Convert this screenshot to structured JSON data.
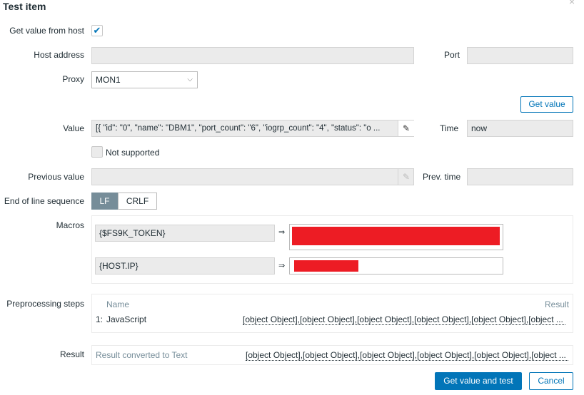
{
  "title": "Test item",
  "close_icon": "×",
  "get_value_from_host": {
    "label": "Get value from host",
    "checked": true
  },
  "host_address": {
    "label": "Host address",
    "value": ""
  },
  "port": {
    "label": "Port",
    "value": ""
  },
  "proxy": {
    "label": "Proxy",
    "value": "MON1"
  },
  "get_value_button": "Get value",
  "value": {
    "label": "Value",
    "value": "[{ \"id\": \"0\", \"name\": \"DBM1\", \"port_count\": \"6\", \"iogrp_count\": \"4\", \"status\": \"o ..."
  },
  "time": {
    "label": "Time",
    "value": "now"
  },
  "not_supported": {
    "label": "Not supported",
    "checked": false
  },
  "previous_value": {
    "label": "Previous value",
    "value": ""
  },
  "prev_time": {
    "label": "Prev. time",
    "value": ""
  },
  "eol": {
    "label": "End of line sequence",
    "options": [
      "LF",
      "CRLF"
    ],
    "selected": "LF"
  },
  "macros": {
    "label": "Macros",
    "arrow": "⇒",
    "items": [
      {
        "name": "{$FS9K_TOKEN}"
      },
      {
        "name": "{HOST.IP}"
      }
    ]
  },
  "preprocessing": {
    "label": "Preprocessing steps",
    "col_name": "Name",
    "col_result": "Result",
    "rows": [
      {
        "step": "1:",
        "name": "JavaScript",
        "result": "[object Object],[object Object],[object Object],[object Object],[object Object],[object ..."
      }
    ]
  },
  "result": {
    "label": "Result",
    "type": "Result converted to Text",
    "value": "[object Object],[object Object],[object Object],[object Object],[object Object],[object ..."
  },
  "buttons": {
    "submit": "Get value and test",
    "cancel": "Cancel"
  },
  "colors": {
    "accent": "#0275b8",
    "redacted": "#ed1c24"
  }
}
